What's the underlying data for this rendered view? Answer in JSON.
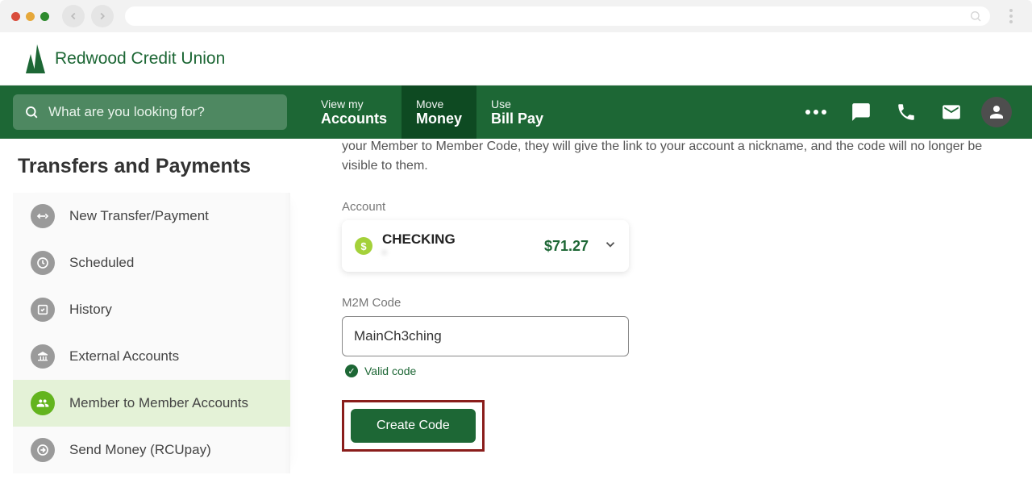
{
  "brand": {
    "name": "Redwood Credit Union"
  },
  "topNav": {
    "searchPlaceholder": "What are you looking for?",
    "items": [
      {
        "top": "View my",
        "bottom": "Accounts"
      },
      {
        "top": "Move",
        "bottom": "Money"
      },
      {
        "top": "Use",
        "bottom": "Bill Pay"
      }
    ]
  },
  "sidebar": {
    "heading": "Transfers and Payments",
    "items": [
      {
        "label": "New Transfer/Payment"
      },
      {
        "label": "Scheduled"
      },
      {
        "label": "History"
      },
      {
        "label": "External Accounts"
      },
      {
        "label": "Member to Member Accounts"
      },
      {
        "label": "Send Money (RCUpay)"
      }
    ]
  },
  "main": {
    "introFragment": "your Member to Member Code, they will give the link to your account a nickname, and the code will no longer be visible to them.",
    "accountLabel": "Account",
    "account": {
      "name": "CHECKING",
      "masked": "*",
      "balance": "$71.27"
    },
    "m2mLabel": "M2M Code",
    "m2mValue": "MainCh3ching",
    "validText": "Valid code",
    "createLabel": "Create Code"
  }
}
